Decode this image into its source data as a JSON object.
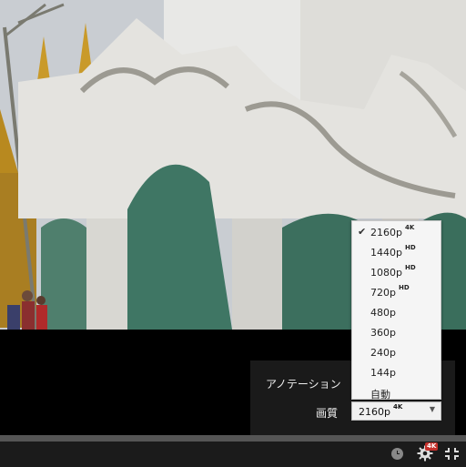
{
  "settings": {
    "annotation_label": "アノテーション",
    "quality_label": "画質",
    "quality_selected": "2160p",
    "quality_selected_badge": "4K"
  },
  "quality_options": [
    {
      "label": "2160p",
      "badge": "4K",
      "checked": true
    },
    {
      "label": "1440p",
      "badge": "HD",
      "checked": false
    },
    {
      "label": "1080p",
      "badge": "HD",
      "checked": false
    },
    {
      "label": "720p",
      "badge": "HD",
      "checked": false
    },
    {
      "label": "480p",
      "badge": "",
      "checked": false
    },
    {
      "label": "360p",
      "badge": "",
      "checked": false
    },
    {
      "label": "240p",
      "badge": "",
      "checked": false
    },
    {
      "label": "144p",
      "badge": "",
      "checked": false
    },
    {
      "label": "自動",
      "badge": "",
      "checked": false
    }
  ],
  "controls": {
    "settings_badge": "4K",
    "icons": [
      "watch-later-icon",
      "gear-icon",
      "exit-fullscreen-icon"
    ]
  },
  "colors": {
    "badge_red": "#c4302b",
    "panel_bg": "#1c1c1c"
  }
}
